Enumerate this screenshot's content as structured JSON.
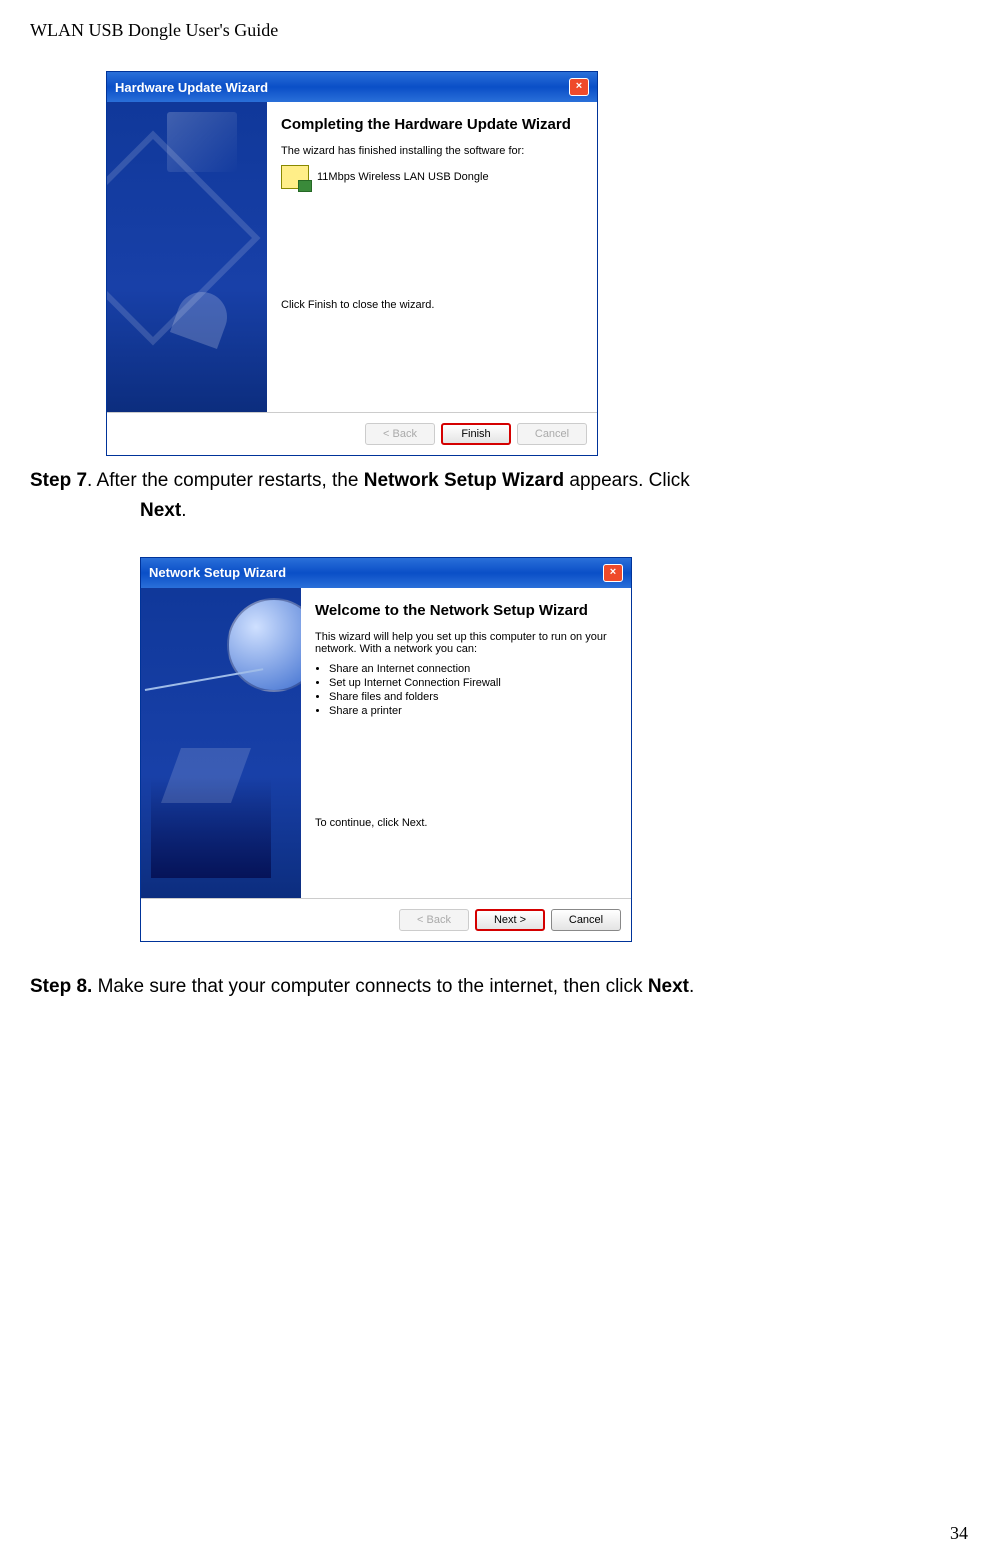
{
  "header": "WLAN USB Dongle User's Guide",
  "page_number": "34",
  "step7": {
    "label": "Step 7",
    "sep": ".",
    "text_before": "   After the computer restarts, the ",
    "bold1": "Network Setup Wizard",
    "text_mid": " appears. Click ",
    "bold2": "Next",
    "tail": "."
  },
  "step8": {
    "label": "Step 8.",
    "text_before": "   Make sure that your computer connects to the internet, then click ",
    "bold1": "Next",
    "tail": "."
  },
  "wizard1": {
    "title": "Hardware Update Wizard",
    "heading": "Completing the Hardware Update Wizard",
    "desc": "The wizard has finished installing the software for:",
    "device": "11Mbps Wireless LAN USB Dongle",
    "closing": "Click Finish to close the wizard.",
    "buttons": {
      "back": "< Back",
      "finish": "Finish",
      "cancel": "Cancel"
    }
  },
  "wizard2": {
    "title": "Network Setup Wizard",
    "heading": "Welcome to the Network Setup Wizard",
    "desc": "This wizard will help you set up this computer to run on your network. With a network you can:",
    "bullets": [
      "Share an Internet connection",
      "Set up Internet Connection Firewall",
      "Share files and folders",
      "Share a printer"
    ],
    "cont": "To continue, click Next.",
    "buttons": {
      "back": "< Back",
      "next": "Next >",
      "cancel": "Cancel"
    }
  }
}
